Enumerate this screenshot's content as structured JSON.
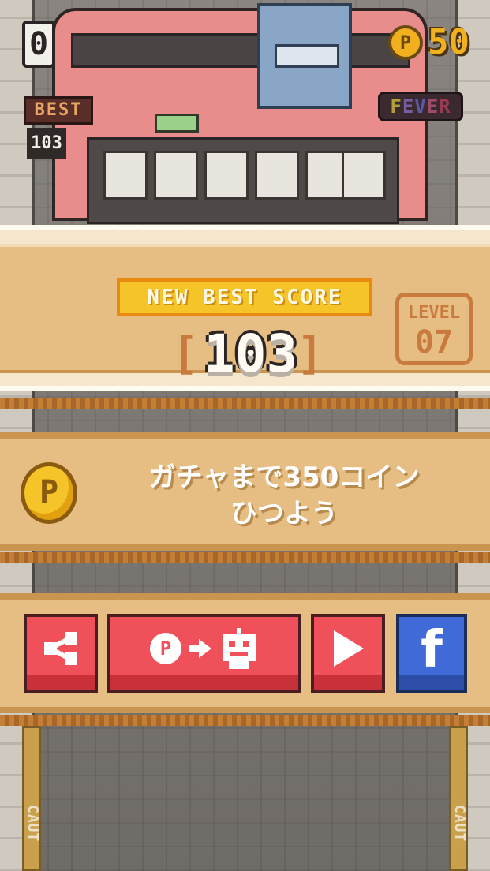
{
  "hud": {
    "current_score": "0",
    "best_label": "BEST",
    "best_value": "103",
    "coins": "50",
    "coin_symbol": "P",
    "fever_letters": [
      "F",
      "E",
      "V",
      "E",
      "R"
    ]
  },
  "result": {
    "banner": "NEW BEST SCORE",
    "bracket_left": "[",
    "bracket_right": "]",
    "score": "103",
    "level_label": "LEVEL",
    "level_value": "07"
  },
  "coin_message": {
    "coin_symbol": "P",
    "line1": "ガチャまで350コイン",
    "line2": "ひつよう"
  },
  "buttons": {
    "share_icon": "share-icon",
    "gacha_coin_symbol": "P",
    "play_icon": "play-icon",
    "facebook_label": "f"
  },
  "scene": {
    "caution_left": "CAUT",
    "caution_right": "CAUT"
  },
  "colors": {
    "panel": "#e6bd82",
    "button_red": "#f0505a",
    "button_blue": "#3f6ad8",
    "banner_yellow": "#f4c428",
    "coin_gold": "#f0b020"
  }
}
